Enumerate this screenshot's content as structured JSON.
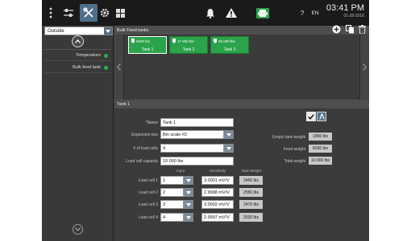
{
  "topbar": {
    "help_label": "?",
    "language": "EN",
    "time": "03:41 PM",
    "date": "01-28-2016",
    "icons": [
      "menu-icon",
      "tools-icon",
      "wrench-screwdriver-icon",
      "gear-icon",
      "grid-icon",
      "bell-icon",
      "warning-icon",
      "printer-icon"
    ]
  },
  "sidebar": {
    "location": "Outside",
    "items": [
      {
        "label": "Temperature",
        "status_color": "#2fae4a"
      },
      {
        "label": "Bulk feed tank",
        "status_color": "#2fae4a"
      }
    ]
  },
  "bulk": {
    "title": "Bulk Feed tanks",
    "tanks": [
      {
        "capacity": "8200 lbs",
        "name": "Tank 1",
        "selected": true
      },
      {
        "capacity": "17 800 lbs",
        "name": "Tank 2",
        "selected": false
      },
      {
        "capacity": "36 090 lbs",
        "name": "Tank 3",
        "selected": false
      }
    ]
  },
  "detail": {
    "title": "Tank 1",
    "name_label": "*Name",
    "name_value": "Tank 1",
    "expansion_label": "Expansion box",
    "expansion_value": "Bin scale #2",
    "load_cells_label": "# of load cells",
    "load_cells_value": "4",
    "capacity_label": "Load cell capacity",
    "capacity_value": "10 000 lbs",
    "empty_weight_label": "Empty tank weight",
    "empty_weight_value": "1800 lbs",
    "feed_weight_label": "Feed weight",
    "feed_weight_value": "8200 lbs",
    "total_weight_label": "Total weight",
    "total_weight_value": "10 000 lbs",
    "col_input": "Input",
    "col_sensitivity": "Sensitivity",
    "col_raw": "Raw Weight",
    "cells": [
      {
        "label": "Load cell 1",
        "input": "1",
        "sensitivity": "3.0001 mV/V",
        "raw": "2450 lbs"
      },
      {
        "label": "Load cell 2",
        "input": "2",
        "sensitivity": "2.9998 mV/V",
        "raw": "2550 lbs"
      },
      {
        "label": "Load cell 3",
        "input": "3",
        "sensitivity": "3.0002 mV/V",
        "raw": "2470 lbs"
      },
      {
        "label": "Load cell 4",
        "input": "4",
        "sensitivity": "2.9997 mV/V",
        "raw": "2530 lbs"
      }
    ],
    "colors": {
      "accent": "#2aa34a",
      "mode_active": "#4f6f8a"
    }
  }
}
